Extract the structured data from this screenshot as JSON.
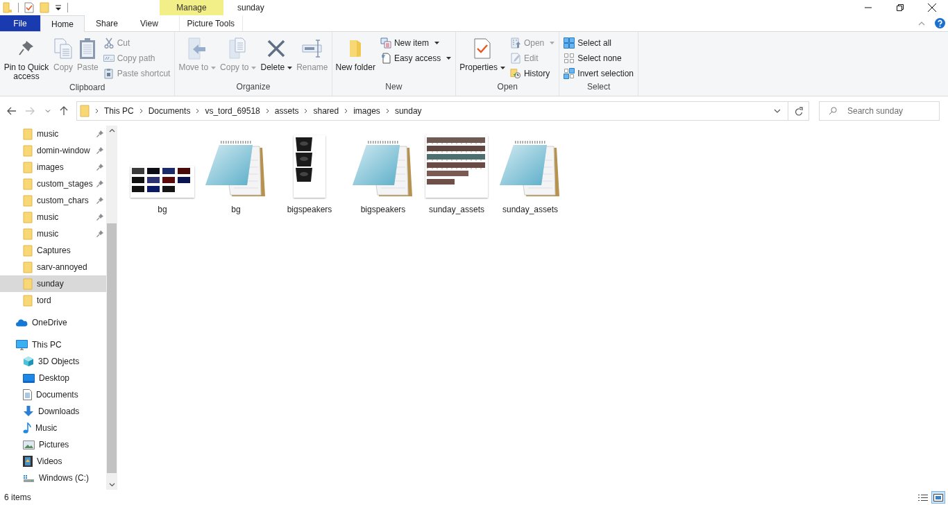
{
  "window": {
    "title": "sunday",
    "contextual_tab": "Manage"
  },
  "tabs": [
    {
      "label": "File",
      "kind": "file",
      "selected": false
    },
    {
      "label": "Home",
      "kind": "tab",
      "selected": true
    },
    {
      "label": "Share",
      "kind": "tab",
      "selected": false
    },
    {
      "label": "View",
      "kind": "tab",
      "selected": false
    },
    {
      "label": "Picture Tools",
      "kind": "contextual",
      "selected": false
    }
  ],
  "ribbon": {
    "groups": [
      {
        "label": "Clipboard",
        "items": [
          {
            "kind": "large",
            "label": "Pin to Quick access",
            "disabled": false,
            "dropdown": false
          },
          {
            "kind": "large",
            "label": "Copy",
            "disabled": true,
            "dropdown": false
          },
          {
            "kind": "large",
            "label": "Paste",
            "disabled": true,
            "dropdown": false
          },
          {
            "kind": "stack",
            "items": [
              {
                "label": "Cut",
                "disabled": true,
                "dropdown": false
              },
              {
                "label": "Copy path",
                "disabled": true,
                "dropdown": false
              },
              {
                "label": "Paste shortcut",
                "disabled": true,
                "dropdown": false
              }
            ]
          }
        ]
      },
      {
        "label": "Organize",
        "items": [
          {
            "kind": "large",
            "label": "Move to",
            "disabled": true,
            "dropdown": true
          },
          {
            "kind": "large",
            "label": "Copy to",
            "disabled": true,
            "dropdown": true
          },
          {
            "kind": "large",
            "label": "Delete",
            "disabled": false,
            "dropdown": true
          },
          {
            "kind": "large",
            "label": "Rename",
            "disabled": true,
            "dropdown": false
          }
        ]
      },
      {
        "label": "New",
        "items": [
          {
            "kind": "large",
            "label": "New folder",
            "disabled": false,
            "dropdown": false
          },
          {
            "kind": "stack",
            "items": [
              {
                "label": "New item",
                "disabled": false,
                "dropdown": true
              },
              {
                "label": "Easy access",
                "disabled": false,
                "dropdown": true
              }
            ]
          }
        ]
      },
      {
        "label": "Open",
        "items": [
          {
            "kind": "large",
            "label": "Properties",
            "disabled": false,
            "dropdown": true
          },
          {
            "kind": "stack",
            "items": [
              {
                "label": "Open",
                "disabled": true,
                "dropdown": true
              },
              {
                "label": "Edit",
                "disabled": true,
                "dropdown": false
              },
              {
                "label": "History",
                "disabled": false,
                "dropdown": false
              }
            ]
          }
        ]
      },
      {
        "label": "Select",
        "items": [
          {
            "kind": "stack",
            "items": [
              {
                "label": "Select all",
                "disabled": false,
                "dropdown": false
              },
              {
                "label": "Select none",
                "disabled": false,
                "dropdown": false
              },
              {
                "label": "Invert selection",
                "disabled": false,
                "dropdown": false
              }
            ]
          }
        ]
      }
    ]
  },
  "address": {
    "path": [
      "This PC",
      "Documents",
      "vs_tord_69518",
      "assets",
      "shared",
      "images",
      "sunday"
    ]
  },
  "search": {
    "placeholder": "Search sunday"
  },
  "navigation": {
    "quick_access": [
      {
        "label": "music",
        "pinned": true,
        "selected": false
      },
      {
        "label": "domin-window",
        "pinned": true,
        "selected": false
      },
      {
        "label": "images",
        "pinned": true,
        "selected": false
      },
      {
        "label": "custom_stages",
        "pinned": true,
        "selected": false
      },
      {
        "label": "custom_chars",
        "pinned": true,
        "selected": false
      },
      {
        "label": "music",
        "pinned": true,
        "selected": false
      },
      {
        "label": "music",
        "pinned": true,
        "selected": false
      },
      {
        "label": "Captures",
        "pinned": false,
        "selected": false
      },
      {
        "label": "sarv-annoyed",
        "pinned": false,
        "selected": false
      },
      {
        "label": "sunday",
        "pinned": false,
        "selected": true
      },
      {
        "label": "tord",
        "pinned": false,
        "selected": false
      }
    ],
    "roots": [
      {
        "label": "OneDrive",
        "kind": "onedrive"
      },
      {
        "label": "This PC",
        "kind": "pc",
        "children": [
          {
            "label": "3D Objects",
            "kind": "objects3d"
          },
          {
            "label": "Desktop",
            "kind": "desktop"
          },
          {
            "label": "Documents",
            "kind": "documents"
          },
          {
            "label": "Downloads",
            "kind": "downloads"
          },
          {
            "label": "Music",
            "kind": "music"
          },
          {
            "label": "Pictures",
            "kind": "pictures"
          },
          {
            "label": "Videos",
            "kind": "videos"
          },
          {
            "label": "Windows (C:)",
            "kind": "drive"
          }
        ]
      }
    ]
  },
  "files": [
    {
      "name": "bg",
      "kind": "picture"
    },
    {
      "name": "bg",
      "kind": "text"
    },
    {
      "name": "bigspeakers",
      "kind": "picture"
    },
    {
      "name": "bigspeakers",
      "kind": "text"
    },
    {
      "name": "sunday_assets",
      "kind": "picture"
    },
    {
      "name": "sunday_assets",
      "kind": "text"
    }
  ],
  "status_bar": {
    "count": "6 items",
    "views": [
      {
        "kind": "details",
        "selected": false
      },
      {
        "kind": "large_icons",
        "selected": true
      }
    ]
  }
}
